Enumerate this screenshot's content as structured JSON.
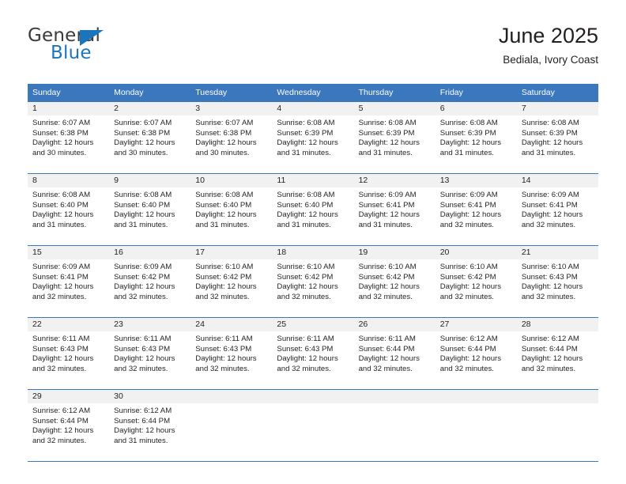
{
  "logo": {
    "word1": "General",
    "word2": "Blue",
    "triangle_color": "#1b75bc"
  },
  "header": {
    "title": "June 2025",
    "subtitle": "Bediala, Ivory Coast",
    "accent_color": "#3b77bd"
  },
  "calendar": {
    "weekday_headers": [
      "Sunday",
      "Monday",
      "Tuesday",
      "Wednesday",
      "Thursday",
      "Friday",
      "Saturday"
    ],
    "labels": {
      "sunrise": "Sunrise:",
      "sunset": "Sunset:",
      "daylight": "Daylight:"
    },
    "weeks": [
      [
        {
          "day": "1",
          "sunrise": "Sunrise: 6:07 AM",
          "sunset": "Sunset: 6:38 PM",
          "daylight1": "Daylight: 12 hours",
          "daylight2": "and 30 minutes."
        },
        {
          "day": "2",
          "sunrise": "Sunrise: 6:07 AM",
          "sunset": "Sunset: 6:38 PM",
          "daylight1": "Daylight: 12 hours",
          "daylight2": "and 30 minutes."
        },
        {
          "day": "3",
          "sunrise": "Sunrise: 6:07 AM",
          "sunset": "Sunset: 6:38 PM",
          "daylight1": "Daylight: 12 hours",
          "daylight2": "and 30 minutes."
        },
        {
          "day": "4",
          "sunrise": "Sunrise: 6:08 AM",
          "sunset": "Sunset: 6:39 PM",
          "daylight1": "Daylight: 12 hours",
          "daylight2": "and 31 minutes."
        },
        {
          "day": "5",
          "sunrise": "Sunrise: 6:08 AM",
          "sunset": "Sunset: 6:39 PM",
          "daylight1": "Daylight: 12 hours",
          "daylight2": "and 31 minutes."
        },
        {
          "day": "6",
          "sunrise": "Sunrise: 6:08 AM",
          "sunset": "Sunset: 6:39 PM",
          "daylight1": "Daylight: 12 hours",
          "daylight2": "and 31 minutes."
        },
        {
          "day": "7",
          "sunrise": "Sunrise: 6:08 AM",
          "sunset": "Sunset: 6:39 PM",
          "daylight1": "Daylight: 12 hours",
          "daylight2": "and 31 minutes."
        }
      ],
      [
        {
          "day": "8",
          "sunrise": "Sunrise: 6:08 AM",
          "sunset": "Sunset: 6:40 PM",
          "daylight1": "Daylight: 12 hours",
          "daylight2": "and 31 minutes."
        },
        {
          "day": "9",
          "sunrise": "Sunrise: 6:08 AM",
          "sunset": "Sunset: 6:40 PM",
          "daylight1": "Daylight: 12 hours",
          "daylight2": "and 31 minutes."
        },
        {
          "day": "10",
          "sunrise": "Sunrise: 6:08 AM",
          "sunset": "Sunset: 6:40 PM",
          "daylight1": "Daylight: 12 hours",
          "daylight2": "and 31 minutes."
        },
        {
          "day": "11",
          "sunrise": "Sunrise: 6:08 AM",
          "sunset": "Sunset: 6:40 PM",
          "daylight1": "Daylight: 12 hours",
          "daylight2": "and 31 minutes."
        },
        {
          "day": "12",
          "sunrise": "Sunrise: 6:09 AM",
          "sunset": "Sunset: 6:41 PM",
          "daylight1": "Daylight: 12 hours",
          "daylight2": "and 31 minutes."
        },
        {
          "day": "13",
          "sunrise": "Sunrise: 6:09 AM",
          "sunset": "Sunset: 6:41 PM",
          "daylight1": "Daylight: 12 hours",
          "daylight2": "and 32 minutes."
        },
        {
          "day": "14",
          "sunrise": "Sunrise: 6:09 AM",
          "sunset": "Sunset: 6:41 PM",
          "daylight1": "Daylight: 12 hours",
          "daylight2": "and 32 minutes."
        }
      ],
      [
        {
          "day": "15",
          "sunrise": "Sunrise: 6:09 AM",
          "sunset": "Sunset: 6:41 PM",
          "daylight1": "Daylight: 12 hours",
          "daylight2": "and 32 minutes."
        },
        {
          "day": "16",
          "sunrise": "Sunrise: 6:09 AM",
          "sunset": "Sunset: 6:42 PM",
          "daylight1": "Daylight: 12 hours",
          "daylight2": "and 32 minutes."
        },
        {
          "day": "17",
          "sunrise": "Sunrise: 6:10 AM",
          "sunset": "Sunset: 6:42 PM",
          "daylight1": "Daylight: 12 hours",
          "daylight2": "and 32 minutes."
        },
        {
          "day": "18",
          "sunrise": "Sunrise: 6:10 AM",
          "sunset": "Sunset: 6:42 PM",
          "daylight1": "Daylight: 12 hours",
          "daylight2": "and 32 minutes."
        },
        {
          "day": "19",
          "sunrise": "Sunrise: 6:10 AM",
          "sunset": "Sunset: 6:42 PM",
          "daylight1": "Daylight: 12 hours",
          "daylight2": "and 32 minutes."
        },
        {
          "day": "20",
          "sunrise": "Sunrise: 6:10 AM",
          "sunset": "Sunset: 6:42 PM",
          "daylight1": "Daylight: 12 hours",
          "daylight2": "and 32 minutes."
        },
        {
          "day": "21",
          "sunrise": "Sunrise: 6:10 AM",
          "sunset": "Sunset: 6:43 PM",
          "daylight1": "Daylight: 12 hours",
          "daylight2": "and 32 minutes."
        }
      ],
      [
        {
          "day": "22",
          "sunrise": "Sunrise: 6:11 AM",
          "sunset": "Sunset: 6:43 PM",
          "daylight1": "Daylight: 12 hours",
          "daylight2": "and 32 minutes."
        },
        {
          "day": "23",
          "sunrise": "Sunrise: 6:11 AM",
          "sunset": "Sunset: 6:43 PM",
          "daylight1": "Daylight: 12 hours",
          "daylight2": "and 32 minutes."
        },
        {
          "day": "24",
          "sunrise": "Sunrise: 6:11 AM",
          "sunset": "Sunset: 6:43 PM",
          "daylight1": "Daylight: 12 hours",
          "daylight2": "and 32 minutes."
        },
        {
          "day": "25",
          "sunrise": "Sunrise: 6:11 AM",
          "sunset": "Sunset: 6:43 PM",
          "daylight1": "Daylight: 12 hours",
          "daylight2": "and 32 minutes."
        },
        {
          "day": "26",
          "sunrise": "Sunrise: 6:11 AM",
          "sunset": "Sunset: 6:44 PM",
          "daylight1": "Daylight: 12 hours",
          "daylight2": "and 32 minutes."
        },
        {
          "day": "27",
          "sunrise": "Sunrise: 6:12 AM",
          "sunset": "Sunset: 6:44 PM",
          "daylight1": "Daylight: 12 hours",
          "daylight2": "and 32 minutes."
        },
        {
          "day": "28",
          "sunrise": "Sunrise: 6:12 AM",
          "sunset": "Sunset: 6:44 PM",
          "daylight1": "Daylight: 12 hours",
          "daylight2": "and 32 minutes."
        }
      ],
      [
        {
          "day": "29",
          "sunrise": "Sunrise: 6:12 AM",
          "sunset": "Sunset: 6:44 PM",
          "daylight1": "Daylight: 12 hours",
          "daylight2": "and 32 minutes."
        },
        {
          "day": "30",
          "sunrise": "Sunrise: 6:12 AM",
          "sunset": "Sunset: 6:44 PM",
          "daylight1": "Daylight: 12 hours",
          "daylight2": "and 31 minutes."
        },
        {
          "day": "",
          "sunrise": "",
          "sunset": "",
          "daylight1": "",
          "daylight2": ""
        },
        {
          "day": "",
          "sunrise": "",
          "sunset": "",
          "daylight1": "",
          "daylight2": ""
        },
        {
          "day": "",
          "sunrise": "",
          "sunset": "",
          "daylight1": "",
          "daylight2": ""
        },
        {
          "day": "",
          "sunrise": "",
          "sunset": "",
          "daylight1": "",
          "daylight2": ""
        },
        {
          "day": "",
          "sunrise": "",
          "sunset": "",
          "daylight1": "",
          "daylight2": ""
        }
      ]
    ]
  }
}
